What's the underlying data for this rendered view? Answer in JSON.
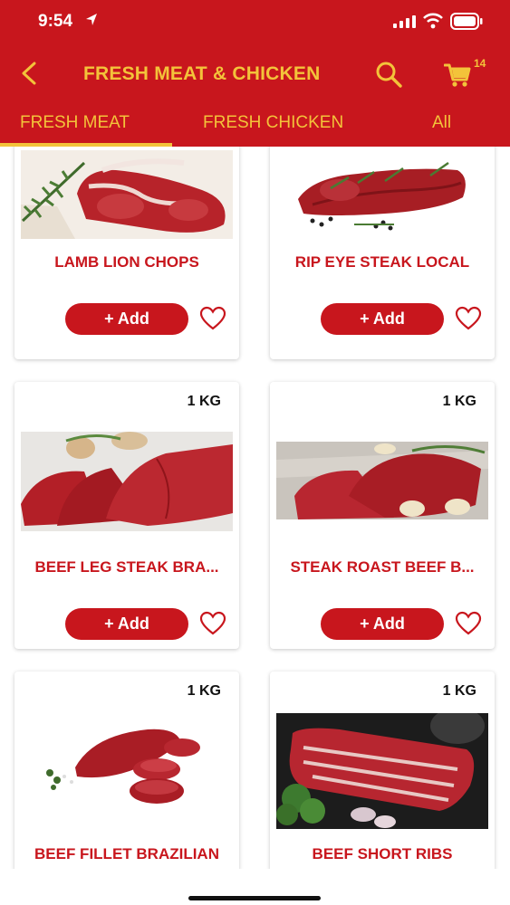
{
  "status_bar": {
    "time": "9:54"
  },
  "header": {
    "title": "FRESH MEAT & CHICKEN",
    "cart_count": "14"
  },
  "tabs": [
    {
      "label": "FRESH MEAT",
      "active": true
    },
    {
      "label": "FRESH CHICKEN",
      "active": false
    },
    {
      "label": "All",
      "active": false
    }
  ],
  "products": [
    {
      "name": "LAMB LION CHOPS",
      "weight": "",
      "add_label": "+ Add",
      "image": "lamb-chops-image"
    },
    {
      "name": "RIP EYE STEAK LOCAL",
      "weight": "",
      "add_label": "+ Add",
      "image": "ribeye-steak-image"
    },
    {
      "name": "BEEF LEG STEAK BRA...",
      "weight": "1 KG",
      "add_label": "+ Add",
      "image": "beef-leg-steak-image"
    },
    {
      "name": "STEAK ROAST BEEF B...",
      "weight": "1 KG",
      "add_label": "+ Add",
      "image": "roast-beef-image"
    },
    {
      "name": "BEEF FILLET BRAZILIAN",
      "weight": "1 KG",
      "add_label": "+ Add",
      "image": "beef-fillet-image"
    },
    {
      "name": "BEEF SHORT RIBS",
      "weight": "1 KG",
      "add_label": "+ Add",
      "image": "short-ribs-image"
    }
  ],
  "colors": {
    "brand_red": "#c8161d",
    "accent_yellow": "#f3c33a"
  }
}
